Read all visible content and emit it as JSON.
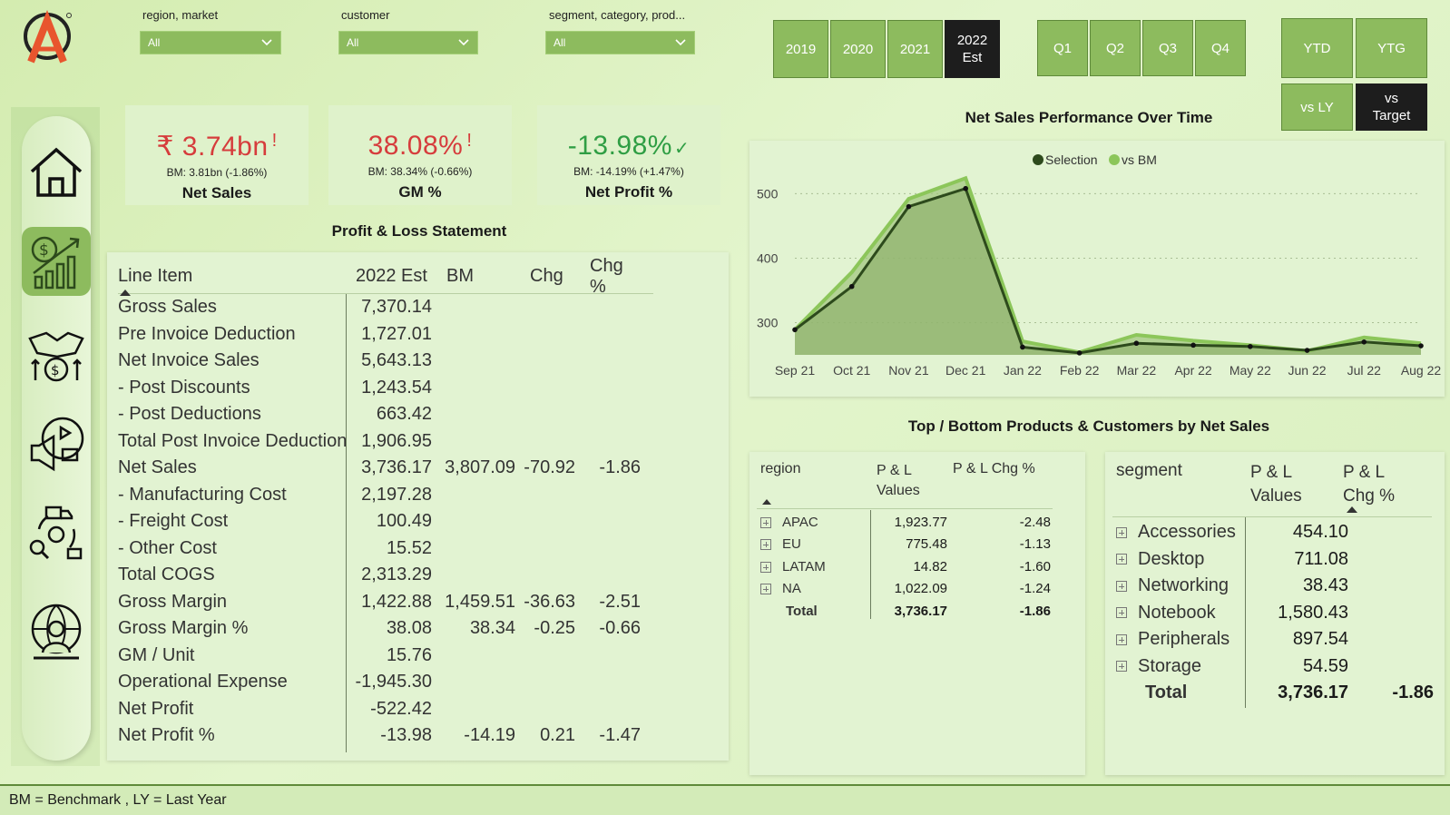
{
  "filters": [
    {
      "label": "region, market",
      "value": "All"
    },
    {
      "label": "customer",
      "value": "All"
    },
    {
      "label": "segment, category, prod...",
      "value": "All"
    }
  ],
  "years": [
    "2019",
    "2020",
    "2021",
    "2022 Est"
  ],
  "active_year": "2022 Est",
  "quarters": [
    "Q1",
    "Q2",
    "Q3",
    "Q4"
  ],
  "periods": [
    "YTD",
    "YTG"
  ],
  "compare": [
    "vs LY",
    "vs Target"
  ],
  "active_compare": "vs Target",
  "nav": [
    "home-icon",
    "finance-growth-icon",
    "handshake-money-icon",
    "marketing-icon",
    "supply-chain-icon",
    "executive-globe-icon"
  ],
  "kpis": [
    {
      "value": "₹ 3.74bn",
      "flag": "!",
      "bm": "BM: 3.81bn (-1.86%)",
      "label": "Net Sales",
      "color": "#d63c3c"
    },
    {
      "value": "38.08%",
      "flag": "!",
      "bm": "BM: 38.34% (-0.66%)",
      "label": "GM %",
      "color": "#d63c3c"
    },
    {
      "value": "-13.98%",
      "flag": "✓",
      "bm": "BM: -14.19% (+1.47%)",
      "label": "Net Profit %",
      "color": "#2f9e44"
    }
  ],
  "pl": {
    "title": "Profit & Loss Statement",
    "headers": [
      "Line Item",
      "2022 Est",
      "BM",
      "Chg",
      "Chg %"
    ],
    "rows": [
      [
        "Gross Sales",
        "7,370.14",
        "",
        "",
        ""
      ],
      [
        "Pre Invoice Deduction",
        "1,727.01",
        "",
        "",
        ""
      ],
      [
        "Net Invoice Sales",
        "5,643.13",
        "",
        "",
        ""
      ],
      [
        "- Post Discounts",
        "1,243.54",
        "",
        "",
        ""
      ],
      [
        "- Post Deductions",
        "663.42",
        "",
        "",
        ""
      ],
      [
        "Total Post Invoice Deduction",
        "1,906.95",
        "",
        "",
        ""
      ],
      [
        "Net Sales",
        "3,736.17",
        "3,807.09",
        "-70.92",
        "-1.86"
      ],
      [
        "- Manufacturing Cost",
        "2,197.28",
        "",
        "",
        ""
      ],
      [
        "- Freight Cost",
        "100.49",
        "",
        "",
        ""
      ],
      [
        "- Other Cost",
        "15.52",
        "",
        "",
        ""
      ],
      [
        "Total COGS",
        "2,313.29",
        "",
        "",
        ""
      ],
      [
        "Gross Margin",
        "1,422.88",
        "1,459.51",
        "-36.63",
        "-2.51"
      ],
      [
        "Gross Margin %",
        "38.08",
        "38.34",
        "-0.25",
        "-0.66"
      ],
      [
        "GM / Unit",
        "15.76",
        "",
        "",
        ""
      ],
      [
        "Operational Expense",
        "-1,945.30",
        "",
        "",
        ""
      ],
      [
        "Net Profit",
        "-522.42",
        "",
        "",
        ""
      ],
      [
        "Net Profit %",
        "-13.98",
        "-14.19",
        "0.21",
        "-1.47"
      ]
    ]
  },
  "chart_data": {
    "type": "area",
    "title": "Net Sales Performance Over Time",
    "x": [
      "Sep 21",
      "Oct 21",
      "Nov 21",
      "Dec 21",
      "Jan 22",
      "Feb 22",
      "Mar 22",
      "Apr 22",
      "May 22",
      "Jun 22",
      "Jul 22",
      "Aug 22"
    ],
    "series": [
      {
        "name": "Selection",
        "values": [
          289,
          356,
          480,
          508,
          262,
          253,
          268,
          265,
          263,
          257,
          270,
          264
        ],
        "color": "#2d4a1c"
      },
      {
        "name": "vs BM",
        "values": [
          289,
          378,
          492,
          524,
          271,
          254,
          281,
          272,
          265,
          256,
          277,
          268
        ],
        "color": "#8cc65a"
      }
    ],
    "yticks": [
      300,
      400,
      500
    ],
    "ylim": [
      250,
      540
    ],
    "legend": "top-center"
  },
  "top_bottom_title": "Top / Bottom Products & Customers by Net Sales",
  "region_table": {
    "headers": [
      "region",
      "P & L Values",
      "P & L Chg %"
    ],
    "rows": [
      [
        "APAC",
        "1,923.77",
        "-2.48"
      ],
      [
        "EU",
        "775.48",
        "-1.13"
      ],
      [
        "LATAM",
        "14.82",
        "-1.60"
      ],
      [
        "NA",
        "1,022.09",
        "-1.24"
      ]
    ],
    "total": [
      "Total",
      "3,736.17",
      "-1.86"
    ]
  },
  "segment_table": {
    "headers": [
      "segment",
      "P & L Values",
      "P & L Chg %"
    ],
    "rows": [
      [
        "Accessories",
        "454.10",
        ""
      ],
      [
        "Desktop",
        "711.08",
        ""
      ],
      [
        "Networking",
        "38.43",
        ""
      ],
      [
        "Notebook",
        "1,580.43",
        ""
      ],
      [
        "Peripherals",
        "897.54",
        ""
      ],
      [
        "Storage",
        "54.59",
        ""
      ]
    ],
    "total": [
      "Total",
      "3,736.17",
      "-1.86"
    ]
  },
  "footer": "BM = Benchmark , LY = Last Year"
}
